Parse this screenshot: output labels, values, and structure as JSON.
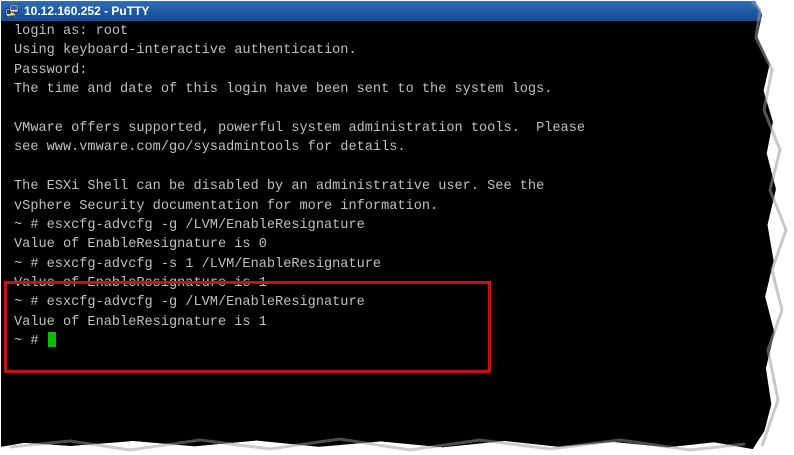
{
  "window": {
    "title": "10.12.160.252 - PuTTY",
    "app_icon": "putty-icon"
  },
  "terminal": {
    "lines": [
      "login as: root",
      "Using keyboard-interactive authentication.",
      "Password:",
      "The time and date of this login have been sent to the system logs.",
      "",
      "VMware offers supported, powerful system administration tools.  Please",
      "see www.vmware.com/go/sysadmintools for details.",
      "",
      "The ESXi Shell can be disabled by an administrative user. See the",
      "vSphere Security documentation for more information.",
      "~ # esxcfg-advcfg -g /LVM/EnableResignature",
      "Value of EnableResignature is 0",
      "~ # esxcfg-advcfg -s 1 /LVM/EnableResignature",
      "Value of EnableResignature is 1",
      "~ # esxcfg-advcfg -g /LVM/EnableResignature",
      "Value of EnableResignature is 1"
    ],
    "prompt": "~ # ",
    "cursor_color": "#00c000"
  },
  "annotation": {
    "highlight_color": "#c81010"
  }
}
